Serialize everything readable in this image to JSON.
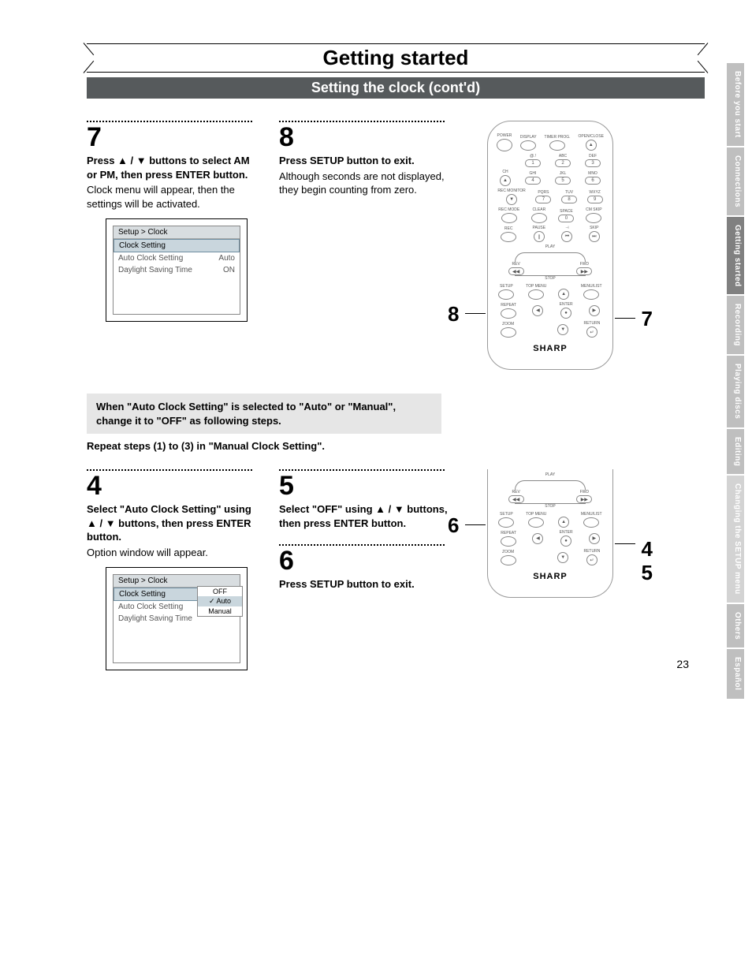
{
  "chapter_title": "Getting started",
  "section_title": "Setting the clock (cont'd)",
  "page_number": "23",
  "side_tabs": [
    {
      "label": "Before you start",
      "state": "inactive"
    },
    {
      "label": "Connections",
      "state": "inactive"
    },
    {
      "label": "Getting started",
      "state": "active"
    },
    {
      "label": "Recording",
      "state": "inactive"
    },
    {
      "label": "Playing discs",
      "state": "inactive"
    },
    {
      "label": "Editing",
      "state": "inactive"
    },
    {
      "label": "Changing the SETUP menu",
      "state": "light"
    },
    {
      "label": "Others",
      "state": "inactive"
    },
    {
      "label": "Español",
      "state": "inactive"
    }
  ],
  "step7": {
    "num": "7",
    "bold": "Press ▲ / ▼ buttons to select AM or PM, then press ENTER button.",
    "body": "Clock menu will appear, then the settings will be activated."
  },
  "step8": {
    "num": "8",
    "bold": "Press SETUP button to exit.",
    "body": "Although seconds are not displayed, they begin counting from zero."
  },
  "osd1": {
    "title": "Setup > Clock",
    "rows": [
      {
        "label": "Clock Setting",
        "value": "",
        "hl": true
      },
      {
        "label": "Auto Clock Setting",
        "value": "Auto"
      },
      {
        "label": "Daylight Saving Time",
        "value": "ON"
      }
    ]
  },
  "note_box": "When \"Auto Clock Setting\" is selected to \"Auto\" or \"Manual\", change it to \"OFF\" as following steps.",
  "repeat_line": "Repeat steps (1) to (3) in \"Manual Clock Setting\".",
  "step4": {
    "num": "4",
    "bold": "Select \"Auto Clock Setting\" using ▲ / ▼ buttons, then press ENTER button.",
    "body": "Option window will appear."
  },
  "step5": {
    "num": "5",
    "bold": "Select \"OFF\" using ▲ / ▼ buttons, then press ENTER button."
  },
  "step6": {
    "num": "6",
    "bold": "Press SETUP button to exit."
  },
  "osd2": {
    "title": "Setup > Clock",
    "rows": [
      {
        "label": "Clock Setting",
        "value": "",
        "hl": true
      },
      {
        "label": "Auto Clock Setting",
        "value": ""
      },
      {
        "label": "Daylight Saving Time",
        "value": ""
      }
    ],
    "popup": [
      "OFF",
      "Auto",
      "Manual"
    ],
    "popup_checked_index": 1
  },
  "remote": {
    "brand": "SHARP",
    "top_labels": [
      "POWER",
      "DISPLAY",
      "TIMER PROG.",
      "OPEN/CLOSE"
    ],
    "keypad_labels_top": [
      "@.!",
      "ABC",
      "DEF"
    ],
    "keypad_labels_mid": [
      "GHI",
      "JKL",
      "MNO"
    ],
    "keypad_labels_bot": [
      "PQRS",
      "TUV",
      "WXYZ"
    ],
    "ch_label": "CH",
    "rec_monitor": "REC MONITOR",
    "row_labels_a": [
      "REC MODE",
      "CLEAR",
      "SPACE",
      "CM SKIP"
    ],
    "row_labels_b": [
      "REC",
      "PAUSE",
      "",
      "SKIP"
    ],
    "transport_labels": {
      "rev": "REV",
      "play": "PLAY",
      "fwd": "FWD",
      "stop": "STOP"
    },
    "nav_labels": {
      "setup": "SETUP",
      "topmenu": "TOP MENU",
      "menulist": "MENU/LIST",
      "repeat": "REPEAT",
      "enter": "ENTER",
      "zoom": "ZOOM",
      "return": "RETURN"
    }
  },
  "callouts_top": {
    "left": "8",
    "right": "7"
  },
  "callouts_bottom": {
    "left": "6",
    "right_top": "4",
    "right_bot": "5"
  }
}
